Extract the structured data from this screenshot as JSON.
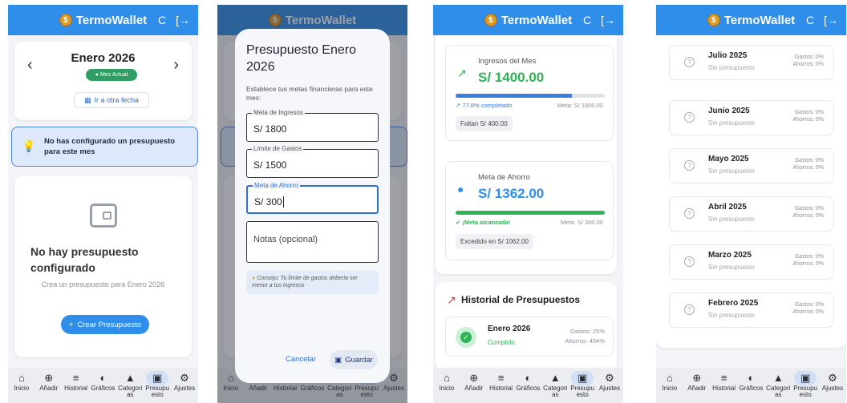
{
  "app": {
    "title": "TermoWallet",
    "coin_icon": "$",
    "refresh_icon": "C",
    "logout_icon": "[→"
  },
  "nav": [
    {
      "label": "Inicio",
      "icon": "⌂"
    },
    {
      "label": "Añadir",
      "icon": "⊕"
    },
    {
      "label": "Historial",
      "icon": "≡"
    },
    {
      "label": "Gráficos",
      "icon": "◐"
    },
    {
      "label": "Categorías",
      "icon": "▲"
    },
    {
      "label": "Presupuesto",
      "icon": "▣"
    },
    {
      "label": "Ajustes",
      "icon": "⚙"
    }
  ],
  "nav_labels_split": {
    "inicio": "Inicio",
    "anadir": "Añadir",
    "historial": "Historial",
    "graficos": "Gráficos",
    "categorias_a": "Categori",
    "categorias_b": "as",
    "presupuesto_a": "Presupu",
    "presupuesto_b": "esto",
    "ajustes": "Ajustes"
  },
  "screen1": {
    "month": "Enero 2026",
    "badge": "Mes Actual",
    "goto_date": "Ir a otra fecha",
    "notice": "No has configurado un presupuesto para este mes",
    "empty_title": "No hay presupuesto configurado",
    "empty_sub": "Crea un presupuesto para Enero 2026",
    "create_btn": "Crear Presupuesto",
    "prev": "‹",
    "next": "›"
  },
  "screen2": {
    "title": "Presupuesto Enero 2026",
    "desc": "Establece tus metas financieras para este mes:",
    "income_label": "Meta de Ingresos",
    "income_value": "S/ 1800",
    "expense_label": "Límite de Gastos",
    "expense_value": "S/ 1500",
    "saving_label": "Meta de Ahorro",
    "saving_value": "S/ 300",
    "notes_placeholder": "Notas (opcional)",
    "tip": "Consejo: Tu límite de gastos debería ser menor a tus ingresos",
    "cancel": "Cancelar",
    "save": "Guardar"
  },
  "screen3": {
    "income": {
      "label": "Ingresos del Mes",
      "amount": "S/ 1400.00",
      "progress": 77.8,
      "status": "77.8% completado",
      "goal": "Meta: S/ 1800.00",
      "chip": "Faltan S/ 400.00"
    },
    "saving": {
      "label": "Meta de Ahorro",
      "amount": "S/ 1362.00",
      "progress": 100,
      "status": "¡Meta alcanzada!",
      "goal": "Meta: S/ 300.00",
      "chip": "Excedido en S/ 1062.00"
    },
    "history_title": "Historial de Presupuestos",
    "history_item": {
      "month": "Enero 2026",
      "status": "Cumplido",
      "gastos": "Gastos: 25%",
      "ahorros": "Ahorros: 454%"
    }
  },
  "screen4": {
    "months": [
      {
        "month": "Julio 2025",
        "sub": "Sin presupuesto",
        "gastos": "Gastos: 0%",
        "ahorros": "Ahorros: 0%"
      },
      {
        "month": "Junio 2025",
        "sub": "Sin presupuesto",
        "gastos": "Gastos: 0%",
        "ahorros": "Ahorros: 0%"
      },
      {
        "month": "Mayo 2025",
        "sub": "Sin presupuesto",
        "gastos": "Gastos: 0%",
        "ahorros": "Ahorros: 0%"
      },
      {
        "month": "Abril 2025",
        "sub": "Sin presupuesto",
        "gastos": "Gastos: 0%",
        "ahorros": "Ahorros: 0%"
      },
      {
        "month": "Marzo 2025",
        "sub": "Sin presupuesto",
        "gastos": "Gastos: 0%",
        "ahorros": "Ahorros: 0%"
      },
      {
        "month": "Febrero 2025",
        "sub": "Sin presupuesto",
        "gastos": "Gastos: 0%",
        "ahorros": "Ahorros: 0%"
      }
    ]
  },
  "colors": {
    "primary": "#2f8eea",
    "success": "#2fb454",
    "progress_blue": "#3a7ee0",
    "badge_green": "#2e9e63"
  }
}
